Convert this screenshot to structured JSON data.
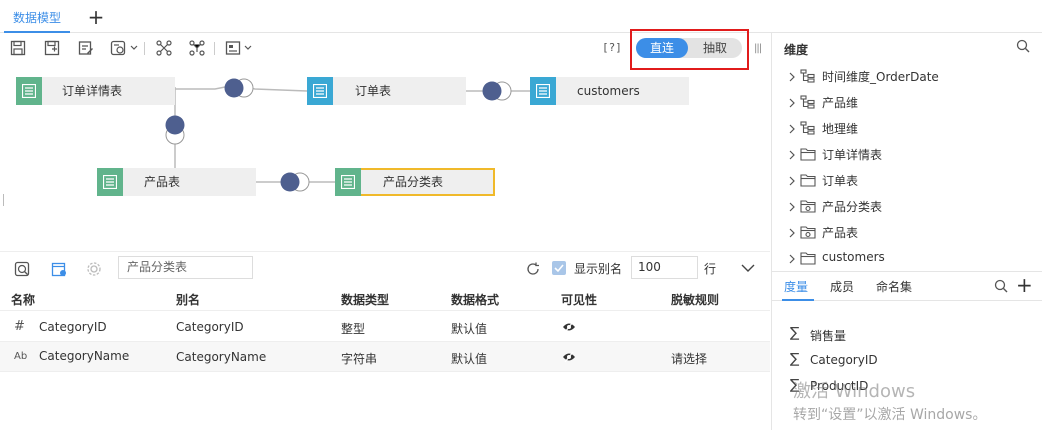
{
  "tabs": {
    "active_label": "数据模型",
    "add_label": "+"
  },
  "toolbar": {
    "help_label": "[?]",
    "mode_direct": "直连",
    "mode_extract": "抽取",
    "grip_label": "|||"
  },
  "canvas": {
    "tables": [
      {
        "label": "订单详情表",
        "color": "#61b48c"
      },
      {
        "label": "订单表",
        "color": "#3aa8d4"
      },
      {
        "label": "customers",
        "color": "#3aa8d4"
      },
      {
        "label": "产品表",
        "color": "#61b48c"
      },
      {
        "label": "产品分类表",
        "color": "#61b48c",
        "selected": true
      }
    ]
  },
  "fields": {
    "search_value": "产品分类表",
    "alias_label": "显示别名",
    "alias_checked": true,
    "rows_value": "100",
    "rows_unit": "行",
    "headers": [
      "名称",
      "别名",
      "数据类型",
      "数据格式",
      "可见性",
      "脱敏规则"
    ],
    "rows": [
      {
        "type_icon": "#",
        "name": "CategoryID",
        "alias": "CategoryID",
        "dtype": "整型",
        "format": "默认值",
        "mask": ""
      },
      {
        "type_icon": "Ab",
        "name": "CategoryName",
        "alias": "CategoryName",
        "dtype": "字符串",
        "format": "默认值",
        "mask": "请选择"
      }
    ]
  },
  "right_panel": {
    "title": "维度",
    "dimensions": [
      {
        "icon": "hierarchy-icon",
        "label": "时间维度_OrderDate"
      },
      {
        "icon": "hierarchy-icon",
        "label": "产品维"
      },
      {
        "icon": "hierarchy-icon",
        "label": "地理维"
      },
      {
        "icon": "folder-icon",
        "label": "订单详情表"
      },
      {
        "icon": "folder-icon",
        "label": "订单表"
      },
      {
        "icon": "folder-linked-icon",
        "label": "产品分类表"
      },
      {
        "icon": "folder-linked-icon",
        "label": "产品表"
      },
      {
        "icon": "folder-icon",
        "label": "customers"
      }
    ],
    "tabs": [
      "度量",
      "成员",
      "命名集"
    ],
    "add_label": "+",
    "measures": [
      {
        "label": "销售量"
      },
      {
        "label": "CategoryID"
      },
      {
        "label": "ProductID"
      }
    ]
  },
  "watermark": {
    "line1": "激活 Windows",
    "line2": "转到“设置”以激活 Windows。"
  },
  "colors": {
    "accent": "#3c8ee7",
    "highlight": "#e11b1b",
    "join": "#4e5f8f",
    "selected_border": "#f0b92a"
  }
}
